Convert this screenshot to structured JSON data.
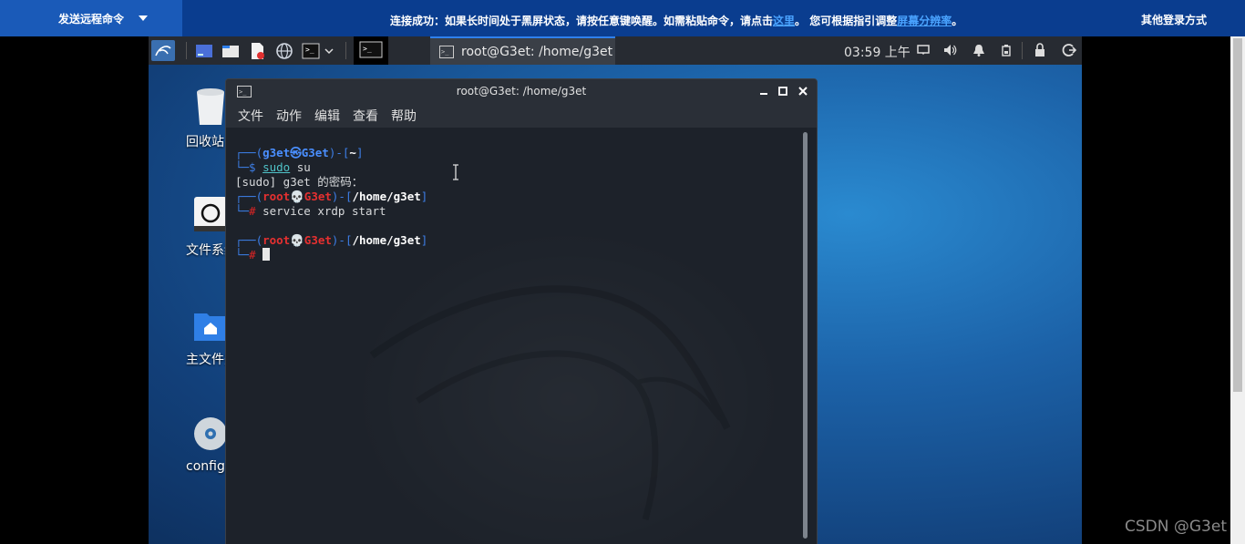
{
  "remote_bar": {
    "command_button": "发送远程命令",
    "notice_prefix": "连接成功：如果长时间处于黑屏状态，请按任意键唤醒。如需粘贴命令，请点击",
    "notice_link1": "这里",
    "notice_middle": "。 您可根据指引调整",
    "notice_link2": "屏幕分辨率",
    "notice_suffix": "。",
    "other_login": "其他登录方式"
  },
  "taskbar": {
    "window_title": "root@G3et: /home/g3et",
    "clock": "03:59 上午"
  },
  "desktop_icons": [
    {
      "label": "回收站",
      "icon": "trash-icon"
    },
    {
      "label": "文件系统",
      "icon": "drive-icon"
    },
    {
      "label": "主文件夹",
      "icon": "home-folder-icon"
    },
    {
      "label": "config-",
      "icon": "disc-icon"
    }
  ],
  "terminal": {
    "title": "root@G3et: /home/g3et",
    "menu": [
      "文件",
      "动作",
      "编辑",
      "查看",
      "帮助"
    ],
    "lines": {
      "l1_user": "g3et",
      "l1_sym": "㉿",
      "l1_host": "G3et",
      "l1_dir": "~",
      "l2_cmd": "sudo",
      "l2_arg": "su",
      "l3": "[sudo] g3et 的密码：",
      "l4_user": "root",
      "l4_sym": "💀",
      "l4_host": "G3et",
      "l4_dir": "/home/g3et",
      "l5_cmd": "service xrdp start",
      "l7_user": "root",
      "l7_sym": "💀",
      "l7_host": "G3et",
      "l7_dir": "/home/g3et"
    }
  },
  "watermark": "CSDN @G3et",
  "colors": {
    "remote_bar": "#0a3d8f",
    "taskbar": "#272b32",
    "terminal_bg": "#1d222a",
    "prompt_blue": "#3d7ee6",
    "prompt_red": "#e02424"
  }
}
